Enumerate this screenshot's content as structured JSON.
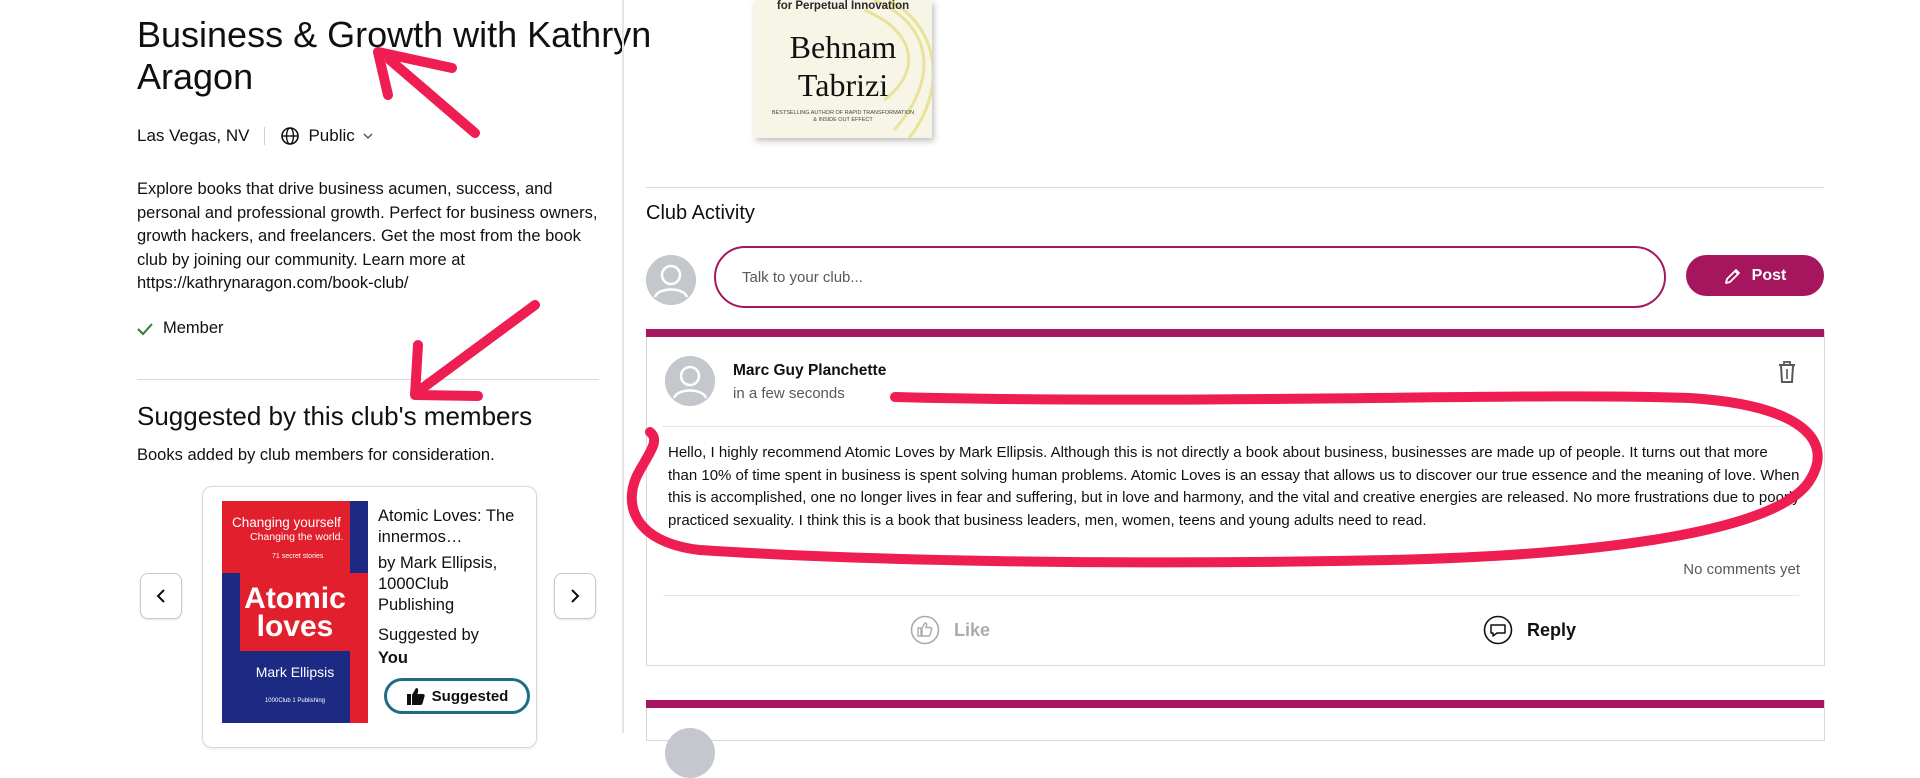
{
  "club": {
    "title": "Business & Growth with Kathryn Aragon",
    "location": "Las Vegas, NV",
    "privacy": "Public",
    "description": "Explore books that drive business acumen, success, and personal and professional growth. Perfect for business owners, growth hackers, and freelancers. Get the most from the book club by joining our community. Learn more at https://kathrynaragon.com/book-club/",
    "membership": "Member"
  },
  "suggested": {
    "heading": "Suggested by this club's members",
    "subheading": "Books added by club members for consideration.",
    "book": {
      "title": "Atomic Loves: The innermos…",
      "author_publisher": "by Mark Ellipsis, 1000Club Publishing",
      "suggested_by_label": "Suggested by",
      "suggested_by_name": "You",
      "badge": "Suggested",
      "cover": {
        "tagline": "Changing yourself",
        "tagline2": "Changing the world.",
        "count": "71 secret stories",
        "title": "Atomic loves",
        "author": "Mark Ellipsis",
        "publisher": "1000Club 1 Publishing"
      }
    }
  },
  "top_book": {
    "tagline": "for Perpetual Innovation",
    "author": "Behnam Tabrizi",
    "blurb": "BESTSELLING AUTHOR OF RAPID TRANSFORMATION & INSIDE OUT EFFECT"
  },
  "activity": {
    "heading": "Club Activity",
    "composer_placeholder": "Talk to your club...",
    "post_button": "Post",
    "post": {
      "author": "Marc Guy Planchette",
      "time": "in a few seconds",
      "body": "Hello, I highly recommend Atomic Loves by Mark Ellipsis. Although this is not directly a book about business, businesses are made up of people. It turns out that more than 10% of time spent in business is spent solving human problems. Atomic Loves is an essay that allows us to discover our true essence and the meaning of love. When this is accomplished, one no longer lives in fear and suffering, but in love and harmony, and the vital and creative energies are released. No more frustrations due to poorly practiced sexuality. I think this is a book that business leaders, men, women, teens and young adults need to read.",
      "comments": "No comments yet",
      "like_label": "Like",
      "reply_label": "Reply"
    }
  },
  "colors": {
    "accent": "#a5165e",
    "annotation": "#ee1d52",
    "suggested_border": "#1c6e86"
  },
  "icons": [
    "globe-icon",
    "chevron-down-icon",
    "check-icon",
    "chevron-left-icon",
    "chevron-right-icon",
    "thumbs-up-icon",
    "pencil-icon",
    "trash-icon",
    "like-icon",
    "reply-icon",
    "user-avatar-icon"
  ]
}
